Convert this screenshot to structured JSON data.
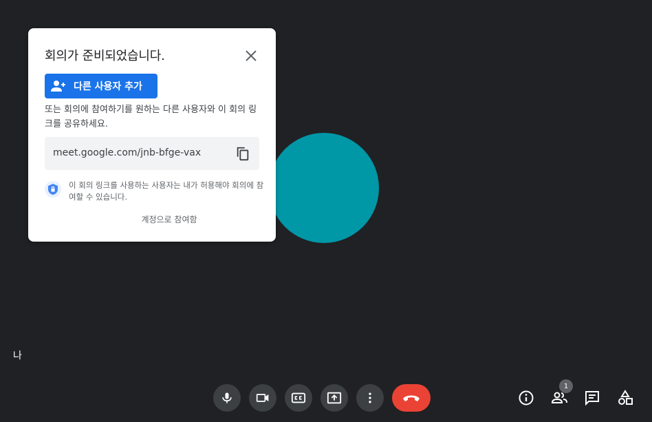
{
  "dialog": {
    "title": "회의가 준비되었습니다.",
    "add_button_label": "다른 사용자 추가",
    "description": "또는 회의에 참여하기를 원하는 다른 사용자와 이 회의 링크를 공유하세요.",
    "meeting_link": "meet.google.com/jnb-bfge-vax",
    "permission_note": "이 회의 링크를 사용하는 사용자는 내가 허용해야 회의에 참여할 수 있습니다.",
    "signin_text": "계정으로 참여함"
  },
  "self_tile": {
    "label": "나",
    "color": "#0097a7"
  },
  "controls": {
    "icons": [
      "mic-icon",
      "camera-icon",
      "captions-icon",
      "present-screen-icon",
      "more-options-icon",
      "hangup-icon"
    ],
    "hangup_color": "#ea4335"
  },
  "right_panel": {
    "icons": [
      "meeting-info-icon",
      "people-icon",
      "chat-icon",
      "activities-icon"
    ],
    "participant_count": "1"
  },
  "colors": {
    "background": "#202124",
    "accent": "#1a73e8"
  }
}
